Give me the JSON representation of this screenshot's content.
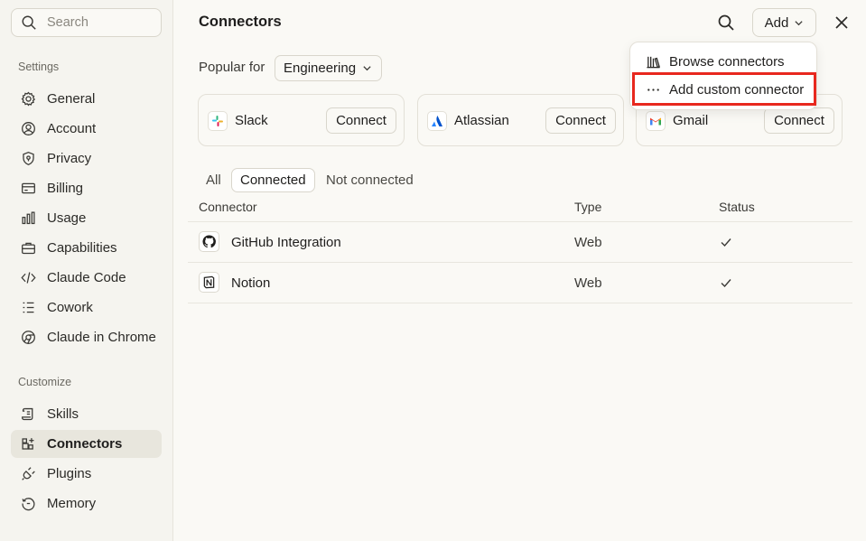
{
  "sidebar": {
    "search_placeholder": "Search",
    "sections": {
      "settings": "Settings",
      "customize": "Customize"
    },
    "settings_items": [
      {
        "label": "General",
        "icon": "gear-icon"
      },
      {
        "label": "Account",
        "icon": "user-circle-icon"
      },
      {
        "label": "Privacy",
        "icon": "shield-icon"
      },
      {
        "label": "Billing",
        "icon": "credit-card-icon"
      },
      {
        "label": "Usage",
        "icon": "bar-chart-icon"
      },
      {
        "label": "Capabilities",
        "icon": "briefcase-icon"
      },
      {
        "label": "Claude Code",
        "icon": "code-icon"
      },
      {
        "label": "Cowork",
        "icon": "checklist-icon"
      },
      {
        "label": "Claude in Chrome",
        "icon": "globe-icon"
      }
    ],
    "customize_items": [
      {
        "label": "Skills",
        "icon": "scroll-icon"
      },
      {
        "label": "Connectors",
        "icon": "grid-plus-icon",
        "active": true
      },
      {
        "label": "Plugins",
        "icon": "plug-icon"
      },
      {
        "label": "Memory",
        "icon": "history-icon"
      }
    ]
  },
  "header": {
    "title": "Connectors",
    "add_label": "Add"
  },
  "popular": {
    "label": "Popular for",
    "selected": "Engineering"
  },
  "cards": [
    {
      "name": "Slack",
      "button": "Connect",
      "icon": "slack-icon"
    },
    {
      "name": "Atlassian",
      "button": "Connect",
      "icon": "atlassian-icon"
    },
    {
      "name": "Gmail",
      "button": "Connect",
      "icon": "gmail-icon"
    }
  ],
  "tabs": [
    "All",
    "Connected",
    "Not connected"
  ],
  "active_tab": "Connected",
  "table": {
    "headers": [
      "Connector",
      "Type",
      "Status"
    ],
    "rows": [
      {
        "name": "GitHub Integration",
        "type": "Web",
        "status": "connected",
        "icon": "github-icon"
      },
      {
        "name": "Notion",
        "type": "Web",
        "status": "connected",
        "icon": "notion-icon"
      }
    ]
  },
  "dropdown": {
    "items": [
      {
        "label": "Browse connectors",
        "icon": "library-icon"
      },
      {
        "label": "Add custom connector",
        "icon": "more-horizontal-icon"
      }
    ]
  },
  "colors": {
    "highlight": "#e8281e",
    "background": "#faf9f5",
    "sidebar_bg": "#f5f4ef"
  }
}
